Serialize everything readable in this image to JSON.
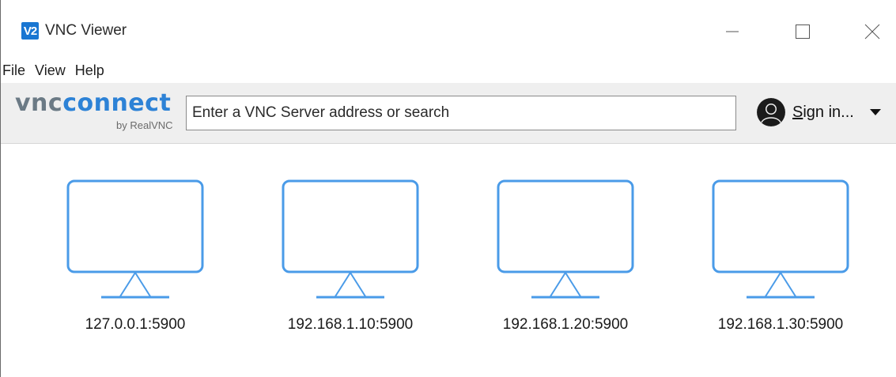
{
  "window": {
    "title": "VNC Viewer",
    "app_icon_text": "V2",
    "controls": [
      "minimize",
      "maximize",
      "close"
    ]
  },
  "menu": {
    "items": [
      {
        "label": "File"
      },
      {
        "label": "View"
      },
      {
        "label": "Help"
      }
    ]
  },
  "toolbar": {
    "brand_vnc": "vnc",
    "brand_connect": "connect",
    "brand_sub": "by RealVNC",
    "search_placeholder": "Enter a VNC Server address or search",
    "search_value": "",
    "signin_first": "S",
    "signin_rest": "ign in...",
    "avatar_icon": "user-avatar-icon"
  },
  "computers": [
    {
      "label": "127.0.0.1:5900"
    },
    {
      "label": "192.168.1.10:5900"
    },
    {
      "label": "192.168.1.20:5900"
    },
    {
      "label": "192.168.1.30:5900"
    }
  ],
  "colors": {
    "accent": "#4a9be8",
    "brand_blue": "#2d82d6",
    "toolbar_bg": "#efefef"
  }
}
